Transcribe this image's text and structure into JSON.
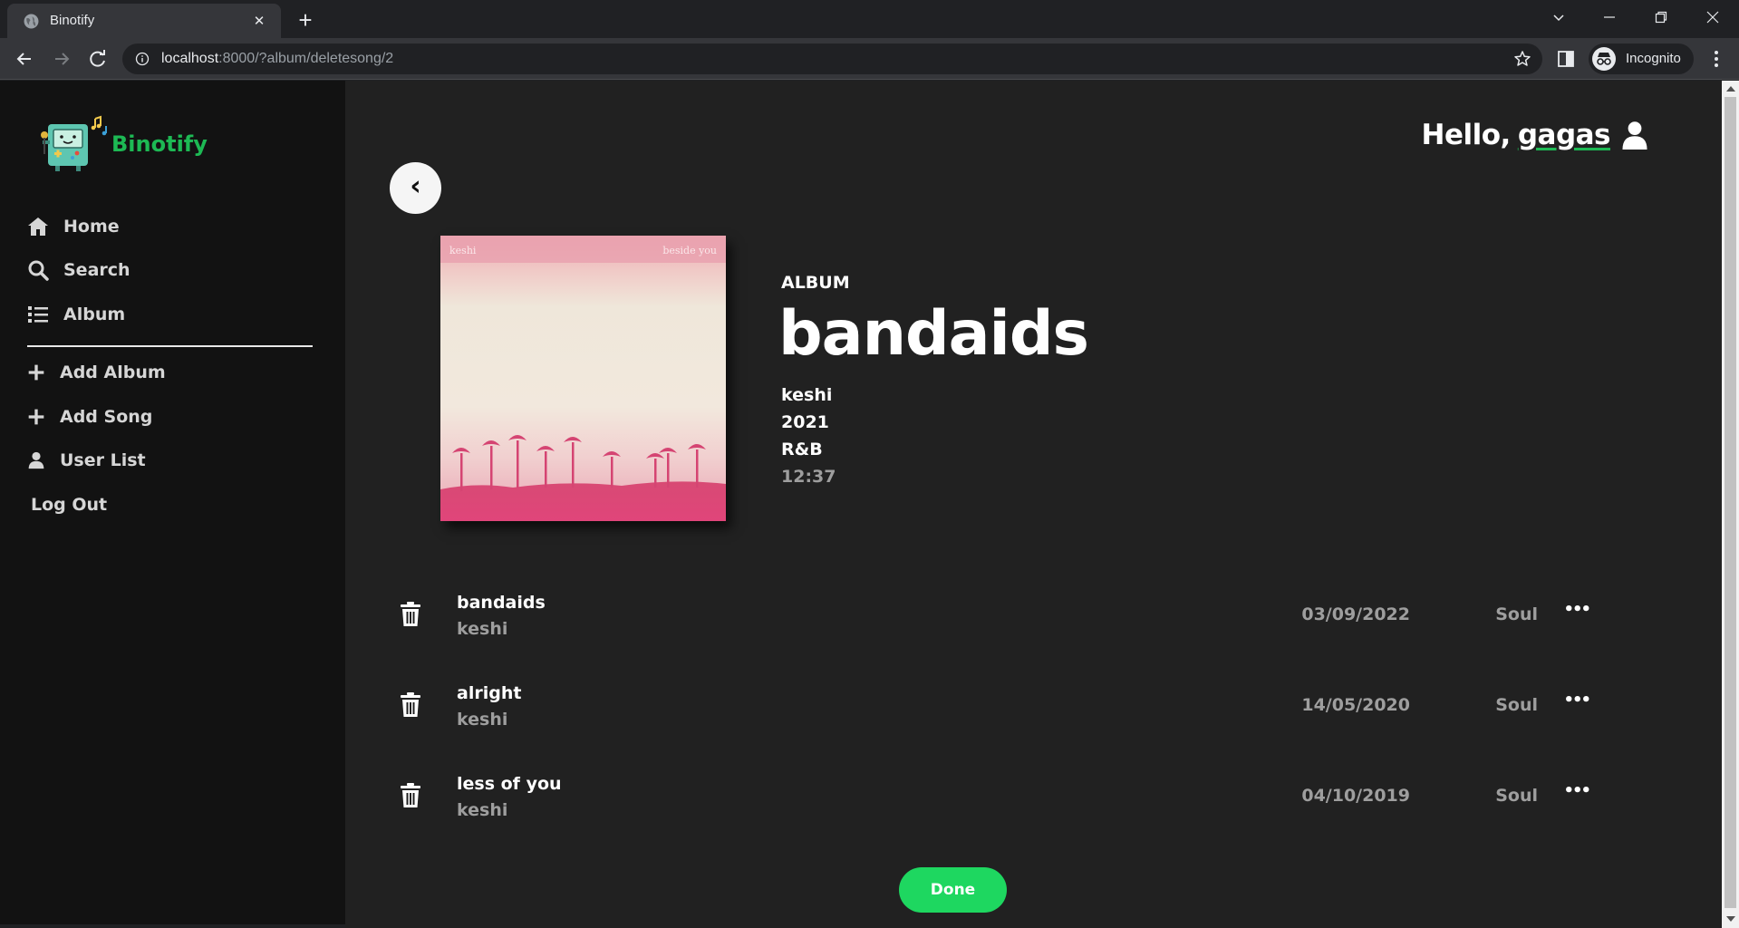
{
  "browser": {
    "tab_title": "Binotify",
    "url_host": "localhost",
    "url_path": ":8000/?album/deletesong/2",
    "profile_label": "Incognito"
  },
  "sidebar": {
    "logo_text": "Binotify",
    "nav": [
      {
        "label": "Home",
        "icon": "home-icon"
      },
      {
        "label": "Search",
        "icon": "search-icon"
      },
      {
        "label": "Album",
        "icon": "list-icon"
      }
    ],
    "admin": [
      {
        "label": "Add Album",
        "icon": "plus-icon"
      },
      {
        "label": "Add Song",
        "icon": "plus-icon"
      },
      {
        "label": "User List",
        "icon": "user-icon"
      }
    ],
    "logout_label": "Log Out"
  },
  "header": {
    "greeting": "Hello,",
    "username": "gagas"
  },
  "album": {
    "type_label": "ALBUM",
    "title": "bandaids",
    "artist": "keshi",
    "year": "2021",
    "genre": "R&B",
    "duration": "12:37",
    "cover_text_left": "keshi",
    "cover_text_right": "beside you"
  },
  "songs": [
    {
      "title": "bandaids",
      "artist": "keshi",
      "date": "03/09/2022",
      "genre": "Soul",
      "more": "•••"
    },
    {
      "title": "alright",
      "artist": "keshi",
      "date": "14/05/2020",
      "genre": "Soul",
      "more": "•••"
    },
    {
      "title": "less of you",
      "artist": "keshi",
      "date": "04/10/2019",
      "genre": "Soul",
      "more": "•••"
    }
  ],
  "actions": {
    "back_glyph": "‹",
    "done_label": "Done"
  },
  "colors": {
    "accent": "#1db954",
    "sidebar_bg": "#121212",
    "main_bg": "#212121"
  }
}
